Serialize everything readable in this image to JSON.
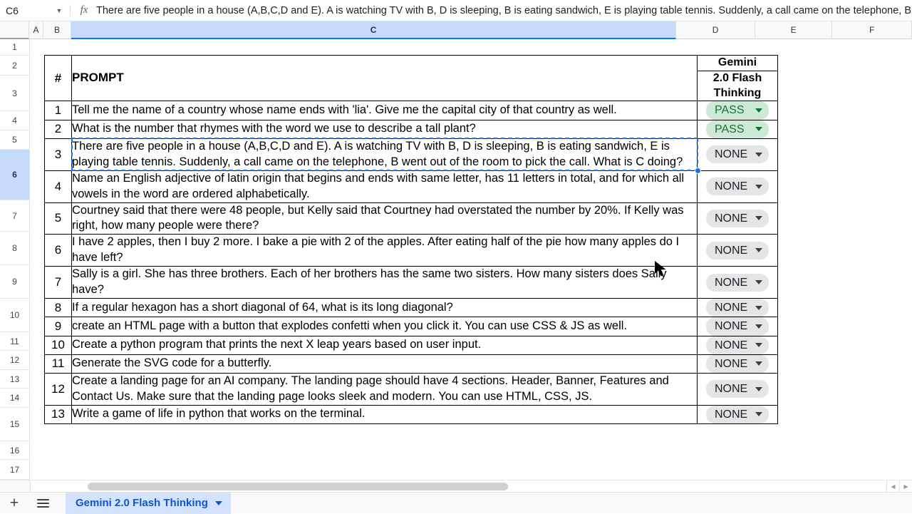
{
  "formula_bar": {
    "name_box_value": "C6",
    "fx_symbol": "fx",
    "formula_text": "There are five people in a house (A,B,C,D and E). A is watching TV with B, D is sleeping, B is eating sandwich, E is playing table tennis. Suddenly, a call came on the telephone, B went out of"
  },
  "column_headers": [
    "A",
    "B",
    "C",
    "D",
    "E",
    "F"
  ],
  "selected_column": "C",
  "selected_row": "6",
  "row_numbers": [
    "1",
    "2",
    "3",
    "4",
    "5",
    "6",
    "7",
    "8",
    "9",
    "10",
    "11",
    "12",
    "13",
    "14",
    "15",
    "16",
    "17"
  ],
  "table": {
    "header": {
      "num": "#",
      "prompt": "PROMPT",
      "model_line1": "Gemini",
      "model_line2": "2.0 Flash Thinking"
    },
    "rows": [
      {
        "num": "1",
        "prompt": "Tell me the name of a country whose name ends with 'lia'. Give me the capital city of that country as well.",
        "status": "PASS"
      },
      {
        "num": "2",
        "prompt": "What is the number that rhymes with the word we use to describe a tall plant?",
        "status": "PASS"
      },
      {
        "num": "3",
        "prompt": "There are five people in a house (A,B,C,D and E). A is watching TV with B, D is sleeping, B is eating sandwich, E is playing table tennis. Suddenly, a call came on the telephone, B went out of the room to pick the call. What is C doing?",
        "status": "NONE"
      },
      {
        "num": "4",
        "prompt": "Name an English adjective of latin origin that begins and ends with same letter, has 11 letters in total, and for which all vowels in the word are ordered alphabetically.",
        "status": "NONE"
      },
      {
        "num": "5",
        "prompt": "Courtney said that there were 48 people, but Kelly said that Courtney had overstated the number by 20%. If Kelly was right, how many people were there?",
        "status": "NONE"
      },
      {
        "num": "6",
        "prompt": "I have 2 apples, then I buy 2 more. I bake a pie with 2 of the apples. After eating half of the pie how many apples do I have left?",
        "status": "NONE"
      },
      {
        "num": "7",
        "prompt": "Sally is a girl. She has three brothers. Each of her brothers has the same two sisters. How many sisters does Sally have?",
        "status": "NONE"
      },
      {
        "num": "8",
        "prompt": "If a regular hexagon has a short diagonal of 64, what is its long diagonal?",
        "status": "NONE"
      },
      {
        "num": "9",
        "prompt": "create an HTML page with a button that explodes confetti when you click it. You can use CSS & JS as well.",
        "status": "NONE"
      },
      {
        "num": "10",
        "prompt": "Create a python program that prints the next X leap years based on user input.",
        "status": "NONE"
      },
      {
        "num": "11",
        "prompt": "Generate the SVG code for a butterfly.",
        "status": "NONE"
      },
      {
        "num": "12",
        "prompt": "Create a landing page for an AI company. The landing page should have 4 sections. Header, Banner, Features and Contact Us. Make sure that the landing page looks sleek and modern. You can use HTML, CSS, JS.",
        "status": "NONE"
      },
      {
        "num": "13",
        "prompt": "Write a game of life in python that works on the terminal.",
        "status": "NONE"
      }
    ]
  },
  "bottom_bar": {
    "add_sheet_label": "+",
    "sheet_tab_label": "Gemini 2.0 Flash Thinking"
  },
  "colors": {
    "pass_bg": "#ceead6",
    "pass_text": "#137333",
    "none_bg": "#e4e5e7",
    "none_text": "#202124",
    "selection_blue": "#1a73e8",
    "header_selected_bg": "#c6dafc",
    "tab_active_bg": "#d3e3fd",
    "tab_active_text": "#0b57d0"
  }
}
